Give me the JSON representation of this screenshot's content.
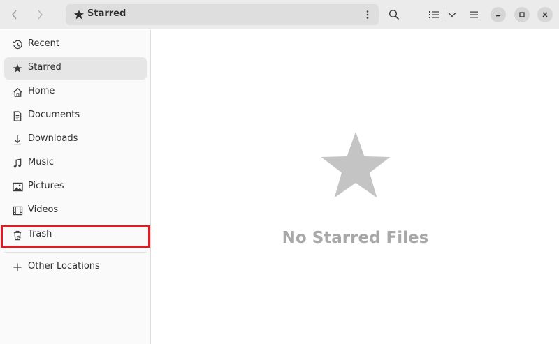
{
  "header": {
    "location_label": "Starred"
  },
  "sidebar": {
    "items": [
      {
        "label": "Recent",
        "icon": "clock-icon"
      },
      {
        "label": "Starred",
        "icon": "star-icon"
      },
      {
        "label": "Home",
        "icon": "home-icon"
      },
      {
        "label": "Documents",
        "icon": "document-icon"
      },
      {
        "label": "Downloads",
        "icon": "download-icon"
      },
      {
        "label": "Music",
        "icon": "music-icon"
      },
      {
        "label": "Pictures",
        "icon": "picture-icon"
      },
      {
        "label": "Videos",
        "icon": "video-icon"
      },
      {
        "label": "Trash",
        "icon": "trash-icon"
      }
    ],
    "other_locations": {
      "label": "Other Locations",
      "icon": "plus-icon"
    }
  },
  "main": {
    "empty_title": "No Starred Files",
    "empty_icon": "star-icon"
  },
  "colors": {
    "highlight": "#e01b24",
    "empty_icon": "#c4c4c4",
    "empty_text": "#a8a8a8"
  }
}
